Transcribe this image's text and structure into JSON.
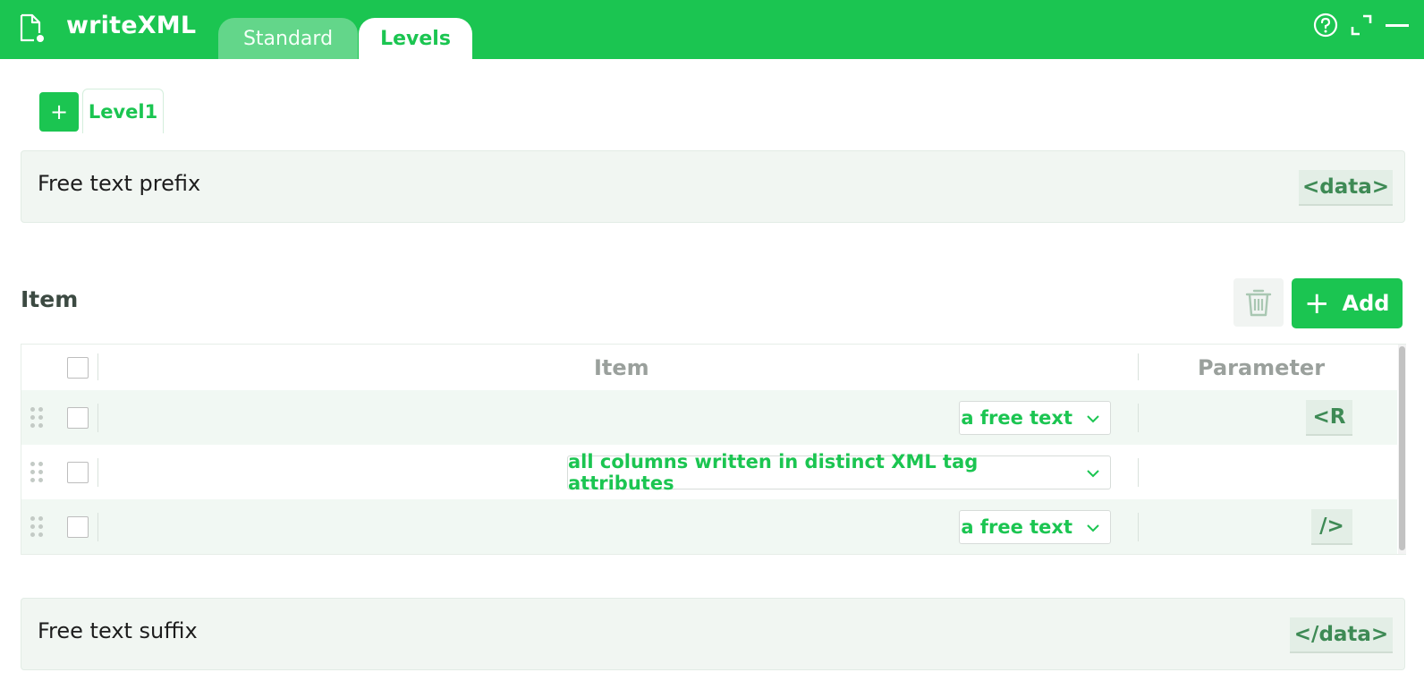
{
  "header": {
    "app_title": "writeXML",
    "tabs": [
      {
        "label": "Standard",
        "active": false
      },
      {
        "label": "Levels",
        "active": true
      }
    ],
    "icons": [
      "help-icon",
      "expand-icon",
      "minimize-icon"
    ]
  },
  "levels": {
    "add_label": "+",
    "tabs": [
      {
        "label": "Level1"
      }
    ]
  },
  "prefix": {
    "label": "Free text prefix",
    "value": "<data>"
  },
  "items_section": {
    "title": "Item",
    "add_label": "Add",
    "columns": [
      "Item",
      "Parameter"
    ],
    "rows": [
      {
        "item": "a free text",
        "parameter": "<R"
      },
      {
        "item": "all columns written in distinct XML tag attributes",
        "parameter": ""
      },
      {
        "item": "a free text",
        "parameter": "/>"
      }
    ]
  },
  "suffix": {
    "label": "Free text suffix",
    "value": "</data>"
  },
  "colors": {
    "accent": "#1bc551",
    "tab_inactive": "#63d68a",
    "panel_bg": "#f1f6f2",
    "tag_text": "#3e8a55"
  }
}
